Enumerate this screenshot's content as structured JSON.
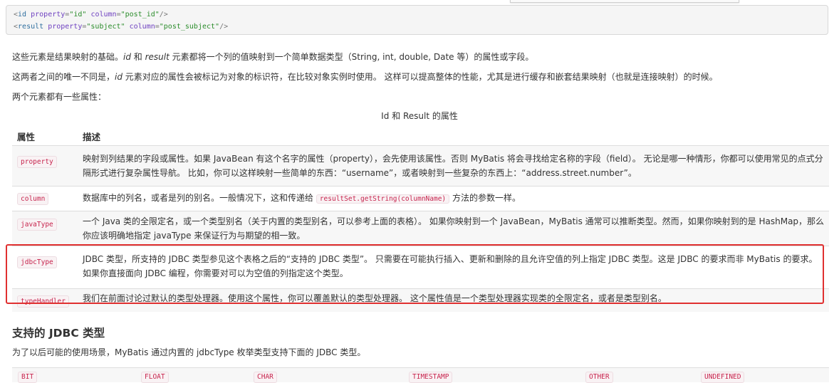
{
  "code": {
    "line1": {
      "open": "<",
      "tag": "id",
      "attr1": "property",
      "eq1": "=",
      "val1": "\"id\"",
      "attr2": "column",
      "eq2": "=",
      "val2": "\"post_id\"",
      "close": "/>"
    },
    "line2": {
      "open": "<",
      "tag": "result",
      "attr1": "property",
      "eq1": "=",
      "val1": "\"subject\"",
      "attr2": "column",
      "eq2": "=",
      "val2": "\"post_subject\"",
      "close": "/>"
    }
  },
  "paragraphs": {
    "p1": {
      "a": "这些元素是结果映射的基础。",
      "b": "id",
      "c": " 和 ",
      "d": "result",
      "e": " 元素都将一个列的值映射到一个简单数据类型（String, int, double, Date 等）的属性或字段。"
    },
    "p2": {
      "a": "这两者之间的唯一不同是，",
      "b": "id",
      "c": " 元素对应的属性会被标记为对象的标识符，在比较对象实例时使用。 这样可以提高整体的性能，尤其是进行缓存和嵌套结果映射（也就是连接映射）的时候。"
    },
    "p3": "两个元素都有一些属性："
  },
  "table": {
    "caption": "Id 和 Result 的属性",
    "headers": [
      "属性",
      "描述"
    ],
    "rows": [
      {
        "term": "property",
        "desc": "映射到列结果的字段或属性。如果 JavaBean 有这个名字的属性（property），会先使用该属性。否则 MyBatis 将会寻找给定名称的字段（field）。 无论是哪一种情形，你都可以使用常见的点式分隔形式进行复杂属性导航。 比如，你可以这样映射一些简单的东西：“username”，或者映射到一些复杂的东西上：“address.street.number”。"
      },
      {
        "term": "column",
        "desc_a": "数据库中的列名，或者是列的别名。一般情况下，这和传递给 ",
        "desc_code": "resultSet.getString(columnName)",
        "desc_b": " 方法的参数一样。"
      },
      {
        "term": "javaType",
        "desc": "一个 Java 类的全限定名，或一个类型别名（关于内置的类型别名，可以参考上面的表格）。 如果你映射到一个 JavaBean，MyBatis 通常可以推断类型。然而，如果你映射到的是 HashMap，那么你应该明确地指定 javaType 来保证行为与期望的相一致。"
      },
      {
        "term": "jdbcType",
        "desc": "JDBC 类型，所支持的 JDBC 类型参见这个表格之后的“支持的 JDBC 类型”。 只需要在可能执行插入、更新和删除的且允许空值的列上指定 JDBC 类型。这是 JDBC 的要求而非 MyBatis 的要求。如果你直接面向 JDBC 编程，你需要对可以为空值的列指定这个类型。"
      },
      {
        "term": "typeHandler",
        "desc": "我们在前面讨论过默认的类型处理器。使用这个属性，你可以覆盖默认的类型处理器。 这个属性值是一个类型处理器实现类的全限定名，或者是类型别名。"
      }
    ]
  },
  "jdbc_section": {
    "title": "支持的 JDBC 类型",
    "intro": "为了以后可能的使用场景，MyBatis 通过内置的 jdbcType 枚举类型支持下面的 JDBC 类型。",
    "types": [
      "BIT",
      "FLOAT",
      "CHAR",
      "TIMESTAMP",
      "OTHER",
      "UNDEFINED"
    ]
  },
  "colors": {
    "highlight": "#e03030",
    "code_accent": "#c7254e"
  }
}
